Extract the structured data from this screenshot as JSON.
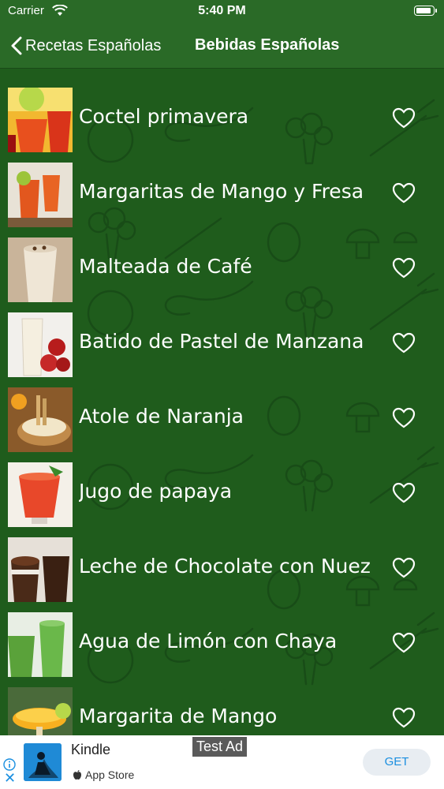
{
  "status_bar": {
    "carrier": "Carrier",
    "time": "5:40 PM"
  },
  "navbar": {
    "back_label": "Recetas Españolas",
    "title": "Bebidas Españolas"
  },
  "recipes": [
    {
      "title": "Coctel primavera",
      "favorite": false
    },
    {
      "title": "Margaritas de Mango y Fresa",
      "favorite": false
    },
    {
      "title": "Malteada de Café",
      "favorite": false
    },
    {
      "title": "Batido de Pastel de Manzana",
      "favorite": false
    },
    {
      "title": "Atole de Naranja",
      "favorite": false
    },
    {
      "title": "Jugo de papaya",
      "favorite": false
    },
    {
      "title": "Leche de Chocolate con Nuez",
      "favorite": false
    },
    {
      "title": "Agua de Limón con Chaya",
      "favorite": false
    },
    {
      "title": "Margarita de Mango",
      "favorite": false
    }
  ],
  "ad": {
    "label": "Test Ad",
    "app_name": "Kindle",
    "store": "App Store",
    "get_label": "GET",
    "close_label": "✕"
  },
  "colors": {
    "background": "#1f5c1c",
    "navbar": "#2a6a27",
    "accent": "#1a8fe0"
  }
}
